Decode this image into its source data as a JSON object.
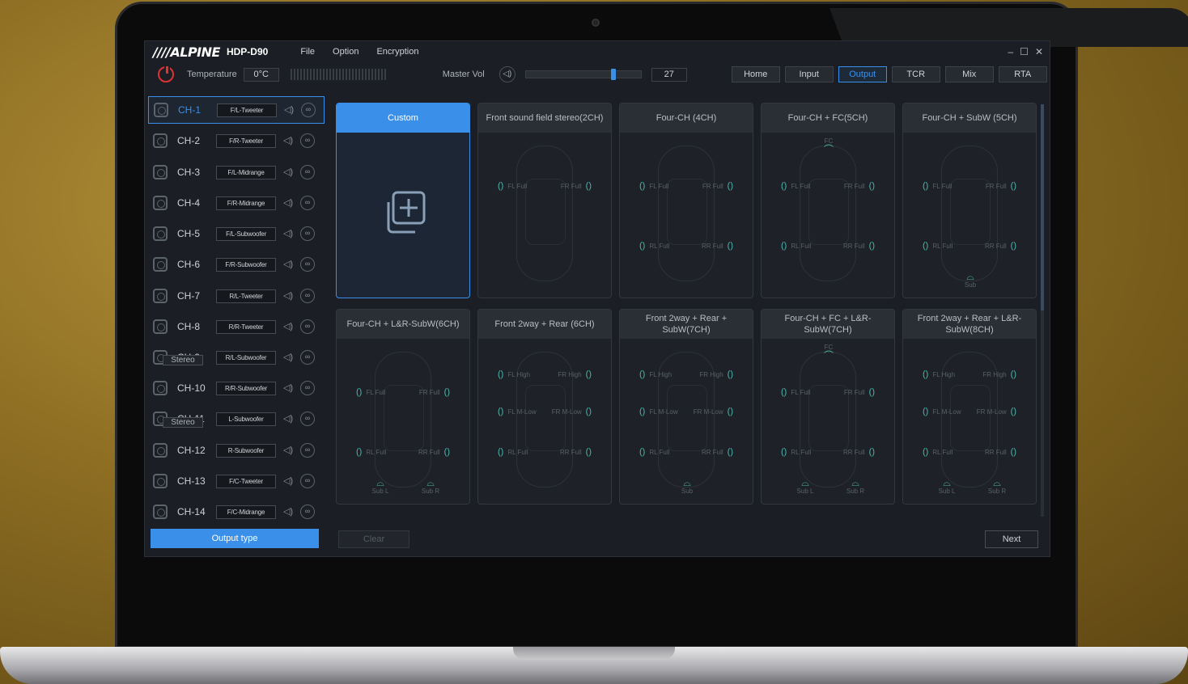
{
  "app": {
    "logo": "////ALPINE",
    "model": "HDP-D90",
    "menu": [
      "File",
      "Option",
      "Encryption"
    ],
    "window_controls": [
      "–",
      "☐",
      "✕"
    ]
  },
  "toolbar": {
    "temperature_label": "Temperature",
    "temperature_value": "0°C",
    "master_vol_label": "Master Vol",
    "master_vol_value": "27",
    "slider_fraction": 0.76,
    "tabs": [
      "Home",
      "Input",
      "Output",
      "TCR",
      "Mix",
      "RTA"
    ],
    "active_tab": "Output"
  },
  "channels": [
    {
      "label": "CH-1",
      "type": "F/L-Tweeter"
    },
    {
      "label": "CH-2",
      "type": "F/R-Tweeter"
    },
    {
      "label": "CH-3",
      "type": "F/L-Midrange"
    },
    {
      "label": "CH-4",
      "type": "F/R-Midrange"
    },
    {
      "label": "CH-5",
      "type": "F/L-Subwoofer"
    },
    {
      "label": "CH-6",
      "type": "F/R-Subwoofer"
    },
    {
      "label": "CH-7",
      "type": "R/L-Tweeter"
    },
    {
      "label": "CH-8",
      "type": "R/R-Tweeter"
    },
    {
      "label": "CH-9",
      "type": "R/L-Subwoofer"
    },
    {
      "label": "CH-10",
      "type": "R/R-Subwoofer"
    },
    {
      "label": "CH-11",
      "type": "L-Subwoofer"
    },
    {
      "label": "CH-12",
      "type": "R-Subwoofer"
    },
    {
      "label": "CH-13",
      "type": "F/C-Tweeter"
    },
    {
      "label": "CH-14",
      "type": "F/C-Midrange"
    }
  ],
  "stereo_label": "Stereo",
  "output_type_button": "Output type",
  "cards": [
    {
      "title": "Custom",
      "active": true,
      "speakers": [],
      "subs": []
    },
    {
      "title": "Front sound field stereo(2CH)",
      "speakers": [
        [
          "FL Full",
          "FR Full"
        ]
      ],
      "subs": []
    },
    {
      "title": "Four-CH (4CH)",
      "speakers": [
        [
          "FL Full",
          "FR Full"
        ],
        [
          "RL Full",
          "RR Full"
        ]
      ],
      "subs": []
    },
    {
      "title": "Four-CH + FC(5CH)",
      "fc": "FC",
      "speakers": [
        [
          "FL Full",
          "FR Full"
        ],
        [
          "RL Full",
          "RR Full"
        ]
      ],
      "subs": []
    },
    {
      "title": "Four-CH + SubW (5CH)",
      "speakers": [
        [
          "FL Full",
          "FR Full"
        ],
        [
          "RL Full",
          "RR Full"
        ]
      ],
      "subs": [
        "Sub"
      ]
    },
    {
      "title": "Four-CH + L&R-SubW(6CH)",
      "speakers": [
        [
          "FL Full",
          "FR Full"
        ],
        [
          "RL Full",
          "RR Full"
        ]
      ],
      "subs": [
        "Sub L",
        "Sub R"
      ]
    },
    {
      "title": "Front 2way + Rear (6CH)",
      "speakers": [
        [
          "FL High",
          "FR High"
        ],
        [
          "FL M-Low",
          "FR M-Low"
        ],
        [
          "RL Full",
          "RR Full"
        ]
      ],
      "subs": []
    },
    {
      "title": "Front 2way + Rear + SubW(7CH)",
      "speakers": [
        [
          "FL High",
          "FR High"
        ],
        [
          "FL M-Low",
          "FR M-Low"
        ],
        [
          "RL Full",
          "RR Full"
        ]
      ],
      "subs": [
        "Sub"
      ]
    },
    {
      "title": "Four-CH + FC + L&R-SubW(7CH)",
      "fc": "FC",
      "speakers": [
        [
          "FL Full",
          "FR Full"
        ],
        [
          "RL Full",
          "RR Full"
        ]
      ],
      "subs": [
        "Sub L",
        "Sub R"
      ]
    },
    {
      "title": "Front 2way + Rear + L&R-SubW(8CH)",
      "speakers": [
        [
          "FL High",
          "FR High"
        ],
        [
          "FL M-Low",
          "FR M-Low"
        ],
        [
          "RL Full",
          "RR Full"
        ]
      ],
      "subs": [
        "Sub L",
        "Sub R"
      ]
    }
  ],
  "clear_button": "Clear",
  "next_button": "Next"
}
